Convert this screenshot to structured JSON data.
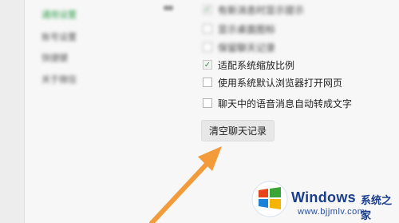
{
  "nav": {
    "items": [
      {
        "label": "通用设置",
        "active": true
      },
      {
        "label": "账号设置",
        "active": false
      },
      {
        "label": "快捷键",
        "active": false
      },
      {
        "label": "关于微信",
        "active": false
      }
    ]
  },
  "settings": {
    "options": [
      {
        "label": "有新消息时显示提示",
        "checked": true,
        "blurred": true
      },
      {
        "label": "显示桌面图标",
        "checked": false,
        "blurred": true
      },
      {
        "label": "保留聊天记录",
        "checked": false,
        "blurred": true
      },
      {
        "label": "适配系统缩放比例",
        "checked": true,
        "blurred": false
      },
      {
        "label": "使用系统默认浏览器打开网页",
        "checked": false,
        "blurred": false
      },
      {
        "label": "聊天中的语音消息自动转成文字",
        "checked": false,
        "blurred": false
      }
    ],
    "clear_button_label": "清空聊天记录"
  },
  "watermark": {
    "title": "Windows",
    "subtitle": "系统之家",
    "url": "www.bjjmlv.com",
    "logo_colors": [
      "#e8441c",
      "#3aa537",
      "#1b82d8",
      "#f5b400"
    ]
  },
  "annotation": {
    "arrow_color": "#f39a3b",
    "arrow_icon": "pointer-arrow-icon"
  }
}
